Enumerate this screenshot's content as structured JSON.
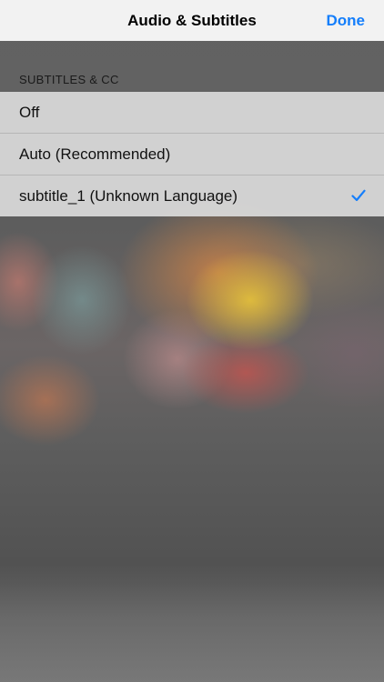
{
  "navbar": {
    "title": "Audio & Subtitles",
    "done_label": "Done",
    "accent_color": "#147efb"
  },
  "subtitles_section": {
    "header": "SUBTITLES & CC",
    "options": [
      {
        "label": "Off",
        "selected": false
      },
      {
        "label": "Auto (Recommended)",
        "selected": false
      },
      {
        "label": "subtitle_1 (Unknown Language)",
        "selected": true
      }
    ]
  },
  "icons": {
    "selected_marker": "checkmark-icon"
  }
}
